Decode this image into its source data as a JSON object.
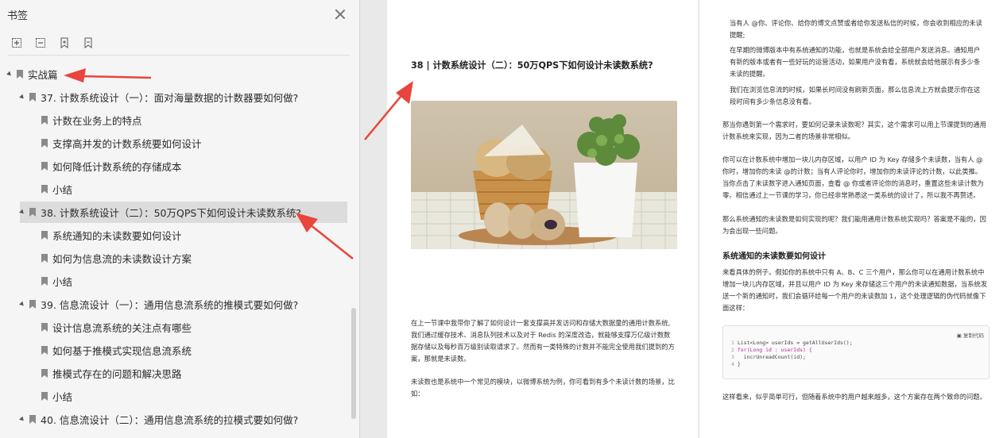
{
  "panel": {
    "title": "书签",
    "toolbar": [
      "expand-all-icon",
      "collapse-all-icon",
      "add-bookmark-icon",
      "remove-bookmark-icon"
    ]
  },
  "tree": [
    {
      "label": "实战篇",
      "level": 0
    },
    {
      "label": "37. 计数系统设计（一）：面对海量数据的计数器要如何做?",
      "level": 1
    },
    {
      "label": "计数在业务上的特点",
      "level": 2
    },
    {
      "label": "支撑高并发的计数系统要如何设计",
      "level": 2
    },
    {
      "label": "如何降低计数系统的存储成本",
      "level": 2
    },
    {
      "label": "小结",
      "level": 2
    },
    {
      "label": "38. 计数系统设计（二）：50万QPS下如何设计未读数系统?",
      "level": 1,
      "selected": true
    },
    {
      "label": "系统通知的未读数要如何设计",
      "level": 2
    },
    {
      "label": "如何为信息流的未读数设计方案",
      "level": 2
    },
    {
      "label": "小结",
      "level": 2
    },
    {
      "label": "39. 信息流设计（一）：通用信息流系统的推模式要如何做?",
      "level": 1
    },
    {
      "label": "设计信息流系统的关注点有哪些",
      "level": 2
    },
    {
      "label": "如何基于推模式实现信息流系统",
      "level": 2
    },
    {
      "label": "推模式存在的问题和解决思路",
      "level": 2
    },
    {
      "label": "小结",
      "level": 2
    },
    {
      "label": "40. 信息流设计（二）：通用信息流系统的拉模式要如何做?",
      "level": 1
    }
  ],
  "left_page": {
    "title": "38 | 计数系统设计（二）：50万QPS下如何设计未读数系统?",
    "para1": [
      "在上一节课中我带你了解了如何设计一套支撑高并发访问和存储大数据量的通用计数系统,",
      "我们通过缓存技术、消息队列技术以及对于 Redis 的深度改造，就能够支撑万亿级计数数",
      "据存储以及每秒百万级别读取请求了。然而有一类特殊的计数并不能完全使用我们提到的方",
      "案，那就是未读数。"
    ],
    "para2": [
      "未读数也是系统中一个常见的模块，以微博系统为例，你可看到有多个未读计数的场景，比",
      "如："
    ]
  },
  "right_page": {
    "bullet1": [
      "当有人 @你、评论你、给你的博文点赞或者给你发送私信的时候，你会收到相应的未读",
      "提醒;"
    ],
    "bullet2": [
      "在早期的微博版本中有系统通知的功能，也就是系统会给全部用户发送消息。通知用户",
      "有新的版本或者有一些好玩的运营活动，如果用户没有看，系统就会给他展示有多少条",
      "未读的提醒。"
    ],
    "bullet3": [
      "我们在浏览信息流的时候，如果长时间没有刷新页面，那么信息流上方就会提示你在这",
      "段时间有多少条信息没有看。"
    ],
    "para1": [
      "那当你遇到第一个需求时，要如何记录未读数呢？其实，这个需求可以用上节课提到的通用",
      "计数系统来实现，因为二者的场景非常相似。"
    ],
    "para2": [
      "你可以在计数系统中增加一块儿内存区域，以用户 ID 为 Key 存储多个未读数，当有人 @",
      "你时，增加你的未读 @的计数；当有人评论你时，增加你的未读评论的计数，以此类推。",
      "当你点击了未读数字进入通知页面，查看 @ 你或者评论你的消息时，重置这些未读计数为",
      "零。相信通过上一节课的学习，你已经非常熟悉这一类系统的设计了，所以我不再赘述。"
    ],
    "para3": [
      "那么系统通知的未读数是如何实现的呢？我们能用通用计数系统实现吗？答案是不能的，因",
      "为会出现一些问题。"
    ],
    "section": "系统通知的未读数要如何设计",
    "para4": [
      "来看具体的例子。假如你的系统中只有 A、B、C 三个用户，那么你可以在通用计数系统中",
      "增加一块儿内存区域，并且以用户 ID 为 Key 来存储这三个用户的未读通知数据，当系统发",
      "送一个新的通知时，我们会循环给每一个用户的未读数加 1，这个处理逻辑的伪代码就像下",
      "面这样："
    ],
    "code_copy": "复制代码",
    "code": [
      {
        "n": "1",
        "text": "List<Long> userIds = getAllUserIds();"
      },
      {
        "n": "2",
        "text": "for(Long id : userIds) {"
      },
      {
        "n": "3",
        "text": "  incrUnreadCount(id);"
      },
      {
        "n": "4",
        "text": "}"
      }
    ],
    "para5": "这样看来，似乎简单可行，但随着系统中的用户越来越多，这个方案存在两个致命的问题。"
  },
  "colors": {
    "annotation": "#e8453c",
    "selected_row": "#dcdcdc"
  }
}
